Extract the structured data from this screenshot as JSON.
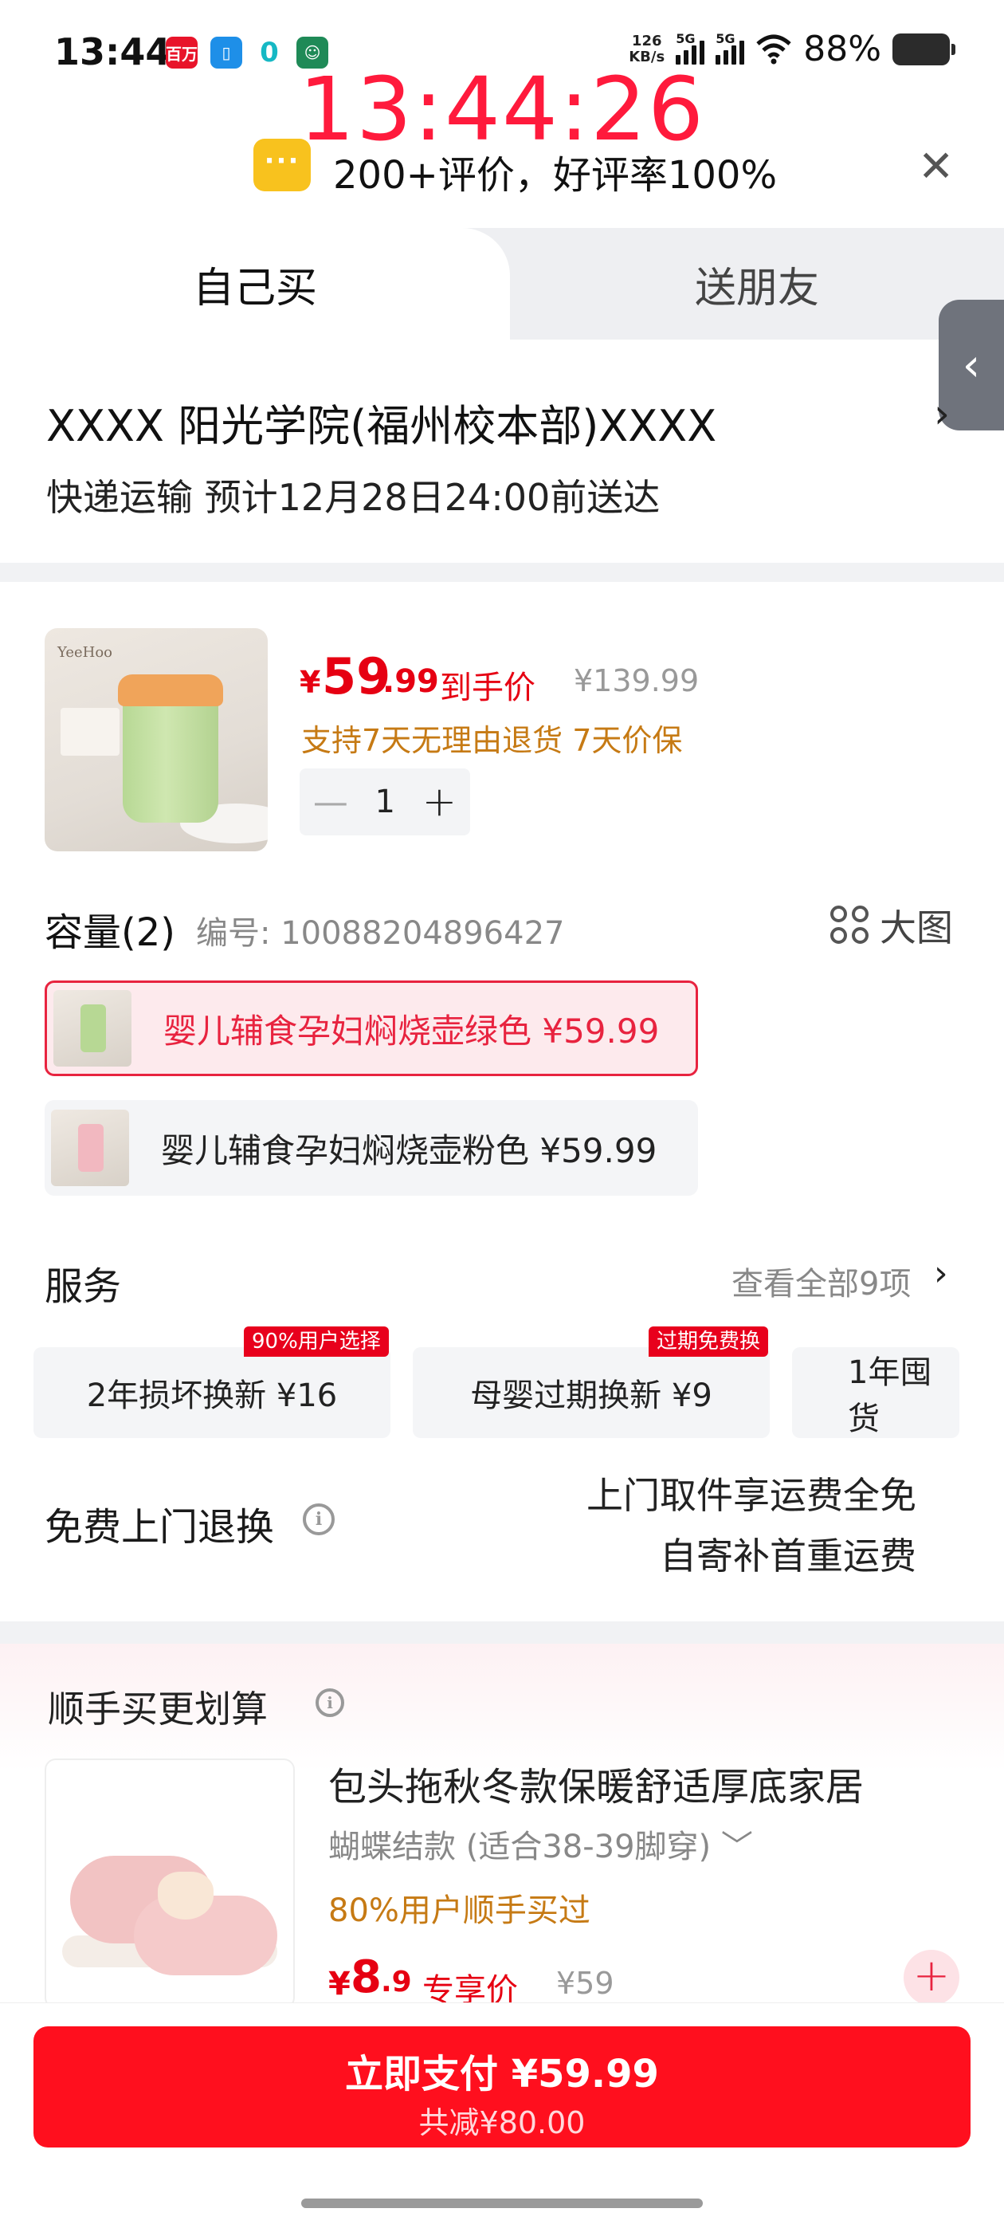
{
  "status_bar": {
    "time": "13:44",
    "net_speed_value": "126",
    "net_speed_unit": "KB/s",
    "signal1_label": "5G",
    "signal2_label": "5G",
    "battery": "88%",
    "app_icons": [
      "news-app-icon",
      "phone-clone-icon",
      "zero-app-icon",
      "avatar-app-icon"
    ],
    "app_icon_0_text": "百万",
    "app_icon_2_text": "0"
  },
  "overlay": {
    "clock": "13:44:26",
    "review": "200+评价，好评率100%"
  },
  "tabs": {
    "self": "自己买",
    "friend": "送朋友"
  },
  "address": {
    "text": "XXXX  阳光学院(福州校本部)XXXX",
    "arrow": "›",
    "delivery": "快递运输 预计12月28日24:00前送达"
  },
  "product": {
    "brand": "YeeHoo",
    "price_currency": "¥",
    "price_int": "59",
    "price_dec": ".99",
    "price_tag": "到手价",
    "original_price": "¥139.99",
    "returns": "支持7天无理由退货  7天价保",
    "quantity": "1",
    "minus": "—",
    "plus": "+"
  },
  "spec": {
    "title": "容量(2)",
    "code": "编号: 10088204896427",
    "big_image": "大图",
    "variants": [
      {
        "label": "婴儿辅食孕妇焖烧壶绿色  ¥59.99",
        "color": "#b7d894",
        "selected": true
      },
      {
        "label": "婴儿辅食孕妇焖烧壶粉色  ¥59.99",
        "color": "#f2b8c0",
        "selected": false
      }
    ]
  },
  "services": {
    "title": "服务",
    "view_all": "查看全部9项",
    "arrow": "›",
    "cards": [
      {
        "label": "2年损坏换新  ¥16",
        "badge": "90%用户选择"
      },
      {
        "label": "母婴过期换新  ¥9",
        "badge": "过期免费换"
      },
      {
        "label": "1年囤货",
        "badge": ""
      }
    ]
  },
  "free_return": {
    "title": "免费上门退换",
    "line1": "上门取件享运费全免",
    "line2": "自寄补首重运费"
  },
  "addon": {
    "title": "顺手买更划算",
    "name": "包头拖秋冬款保暖舒适厚底家居",
    "variant": "蝴蝶结款 (适合38-39脚穿) ﹀",
    "popularity": "80%用户顺手买过",
    "price_currency": "¥",
    "price_int": "8",
    "price_dec": ".9",
    "price_tag": "专享价",
    "original_price": "¥59",
    "add": "+"
  },
  "pay": {
    "main": "立即支付 ¥59.99",
    "sub": "共减¥80.00"
  },
  "colors": {
    "accent": "#e60012",
    "pay_button": "#ff0f1e",
    "overlay_clock": "#ff1a3c",
    "promo": "#c67a14"
  }
}
